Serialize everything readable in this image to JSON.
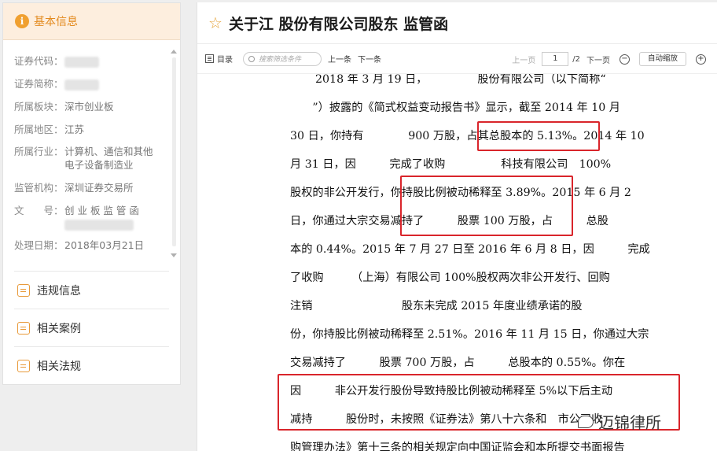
{
  "sidebar": {
    "title": "基本信息",
    "info_icon_glyph": "i",
    "fields": [
      {
        "label": "证券代码：",
        "value": ""
      },
      {
        "label": "证券简称：",
        "value": ""
      },
      {
        "label": "所属板块：",
        "value": "深市创业板"
      },
      {
        "label": "所属地区：",
        "value": "江苏"
      },
      {
        "label": "所属行业：",
        "value": "计算机、通信和其他电子设备制造业"
      },
      {
        "label": "监管机构：",
        "value": "深圳证券交易所"
      },
      {
        "label": "文　　号：",
        "value": "创 业 板 监 管 函"
      },
      {
        "label": "处理日期：",
        "value": "2018年03月21日"
      }
    ],
    "links": [
      {
        "label": "违规信息",
        "icon": "violation-icon"
      },
      {
        "label": "相关案例",
        "icon": "case-icon"
      },
      {
        "label": "相关法规",
        "icon": "regulation-icon"
      }
    ]
  },
  "doc": {
    "title": "关于江 股份有限公司股东 监管函",
    "toolbar": {
      "toc": "目录",
      "search_placeholder": "搜索筛选条件",
      "prev_match": "上一条",
      "next_match": "下一条",
      "prev_page": "上一页",
      "page_current": "1",
      "page_total": "/2",
      "next_page": "下一页",
      "zoom_out": "−",
      "zoom_mode": "自动缩放",
      "zoom_in": "+"
    },
    "lines": [
      "2018 年 3 月 19 日，　　　　　股份有限公司（以下简称“　",
      "　　”）披露的《简式权益变动报告书》显示，截至 2014 年 10 月",
      "30 日，你持有　　　　900 万股，占其总股本的 5.13%。2014 年 10",
      "月 31 日，因　　　完成了收购　　　　　科技有限公司　100%",
      "股权的非公开发行，你持股比例被动稀释至 3.89%。2015 年 6 月 2",
      "日，你通过大宗交易减持了　　　股票 100 万股，占　　　总股",
      "本的 0.44%。2015 年 7 月 27 日至 2016 年 6 月 8 日，因　　　完成",
      "了收购　　　（上海）有限公司 100%股权两次非公开发行、回购",
      "注销　　　　　　　　股东未完成 2015 年度业绩承诺的股",
      "份，你持股比例被动稀释至 2.51%。2016 年 11 月 15 日，你通过大宗",
      "交易减持了　　　股票 700 万股，占　　　总股本的 0.55%。你在",
      "因　　　非公开发行股份导致持股比例被动稀释至 5%以下后主动",
      "减持　　　股份时，未按照《证券法》第八十六条和　市公司收",
      "购管理办法》第十三条的相关规定向中国证监会和本所提交书面报告"
    ]
  },
  "watermark": "迈锦律所",
  "colors": {
    "accent": "#e38a1e",
    "highlight": "#d9252b"
  }
}
